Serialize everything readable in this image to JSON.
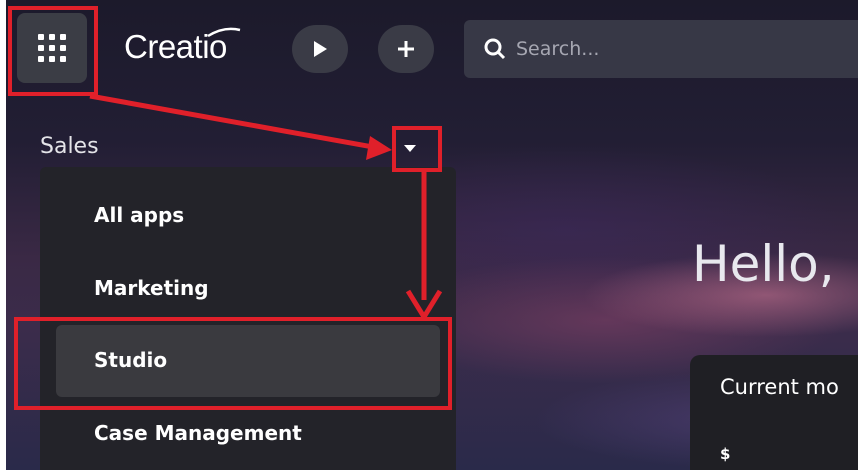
{
  "header": {
    "brand": "Creatio",
    "apps_icon": "apps-grid-icon",
    "run_icon": "play-icon",
    "add_icon": "plus-icon",
    "search_placeholder": "Search..."
  },
  "app_switcher": {
    "current": "Sales",
    "items": [
      {
        "label": "All apps"
      },
      {
        "label": "Marketing"
      },
      {
        "label": "Studio",
        "highlighted": true
      },
      {
        "label": "Case Management"
      }
    ]
  },
  "main": {
    "greeting": "Hello,",
    "card_title": "Current mo",
    "card_value": "$"
  },
  "colors": {
    "annotation": "#e0202a",
    "menu_bg": "#232329",
    "highlight_bg": "#3a3a3f"
  }
}
